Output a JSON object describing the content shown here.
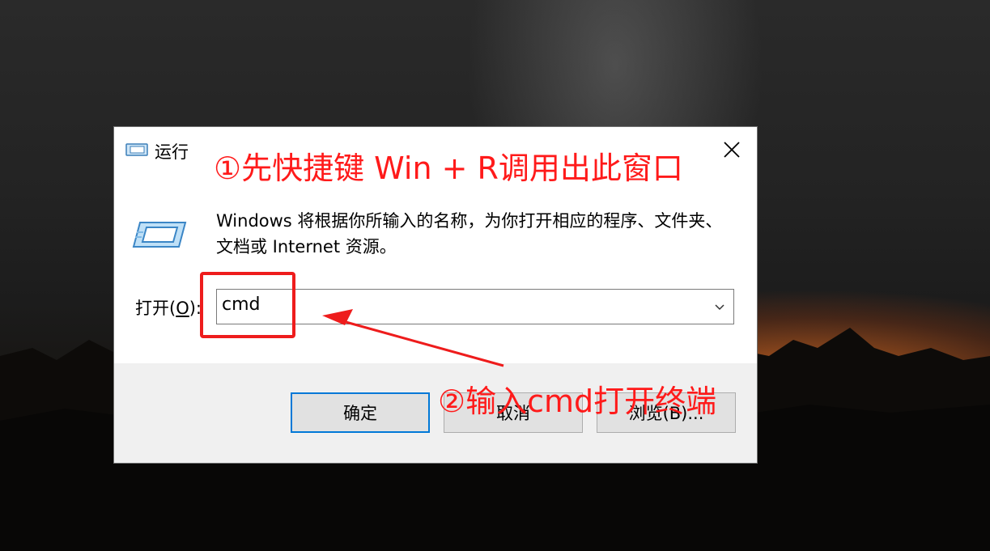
{
  "window": {
    "title": "运行",
    "description": "Windows 将根据你所输入的名称，为你打开相应的程序、文件夹、文档或 Internet 资源。"
  },
  "open_field": {
    "label_prefix": "打开(",
    "label_key": "O",
    "label_suffix": "):",
    "value": "cmd"
  },
  "buttons": {
    "ok": "确定",
    "cancel": "取消",
    "browse": "浏览(B)..."
  },
  "annotations": {
    "step1": "①先快捷键 Win + R调用出此窗口",
    "step2": "②输入cmd打开终端"
  },
  "colors": {
    "annotation": "#ff1a1a",
    "focus_border": "#0078d7"
  },
  "icons": {
    "title": "run-icon",
    "close": "close-icon",
    "dropdown": "chevron-down-icon"
  }
}
